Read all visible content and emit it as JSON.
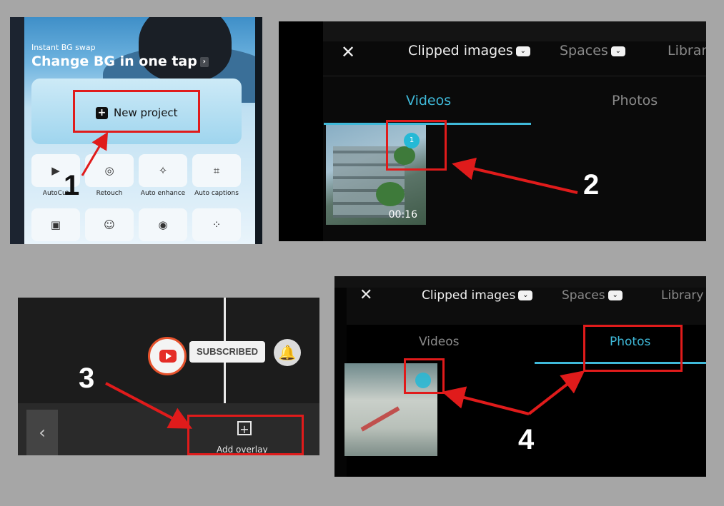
{
  "panel1": {
    "subtitle": "Instant BG swap",
    "title": "Change BG in one tap",
    "chevron": "›",
    "new_project_label": "New project",
    "new_project_icon": "+",
    "tools_row1": [
      {
        "icon": "▶",
        "label": "AutoCut"
      },
      {
        "icon": "◎",
        "label": "Retouch"
      },
      {
        "icon": "✧",
        "label": "Auto enhance"
      },
      {
        "icon": "⌗",
        "label": "Auto captions"
      }
    ],
    "tools_row2": [
      {
        "icon": "▣"
      },
      {
        "icon": "☺"
      },
      {
        "icon": "◉"
      },
      {
        "icon": "⁘"
      }
    ]
  },
  "panel2": {
    "close_icon": "✕",
    "tabs": [
      "Clipped images",
      "Spaces",
      "Library"
    ],
    "dropdown_glyph": "⌄",
    "subtabs": [
      "Videos",
      "Photos"
    ],
    "duration": "00:16",
    "selection_badge": "1"
  },
  "panel3": {
    "subscribed_label": "SUBSCRIBED",
    "bell_icon": "🔔",
    "back_icon": "‹",
    "add_overlay_icon": "+",
    "add_overlay_label": "Add overlay"
  },
  "panel4": {
    "close_icon": "✕",
    "tabs": [
      "Clipped images",
      "Spaces",
      "Library"
    ],
    "dropdown_glyph": "⌄",
    "subtabs": [
      "Videos",
      "Photos"
    ]
  },
  "step_labels": [
    "1",
    "2",
    "3",
    "4"
  ],
  "colors": {
    "background": "#a6a6a6",
    "highlight_red": "#e01b1b",
    "accent_cyan": "#3fb9d9",
    "youtube_red": "#e52d27"
  }
}
